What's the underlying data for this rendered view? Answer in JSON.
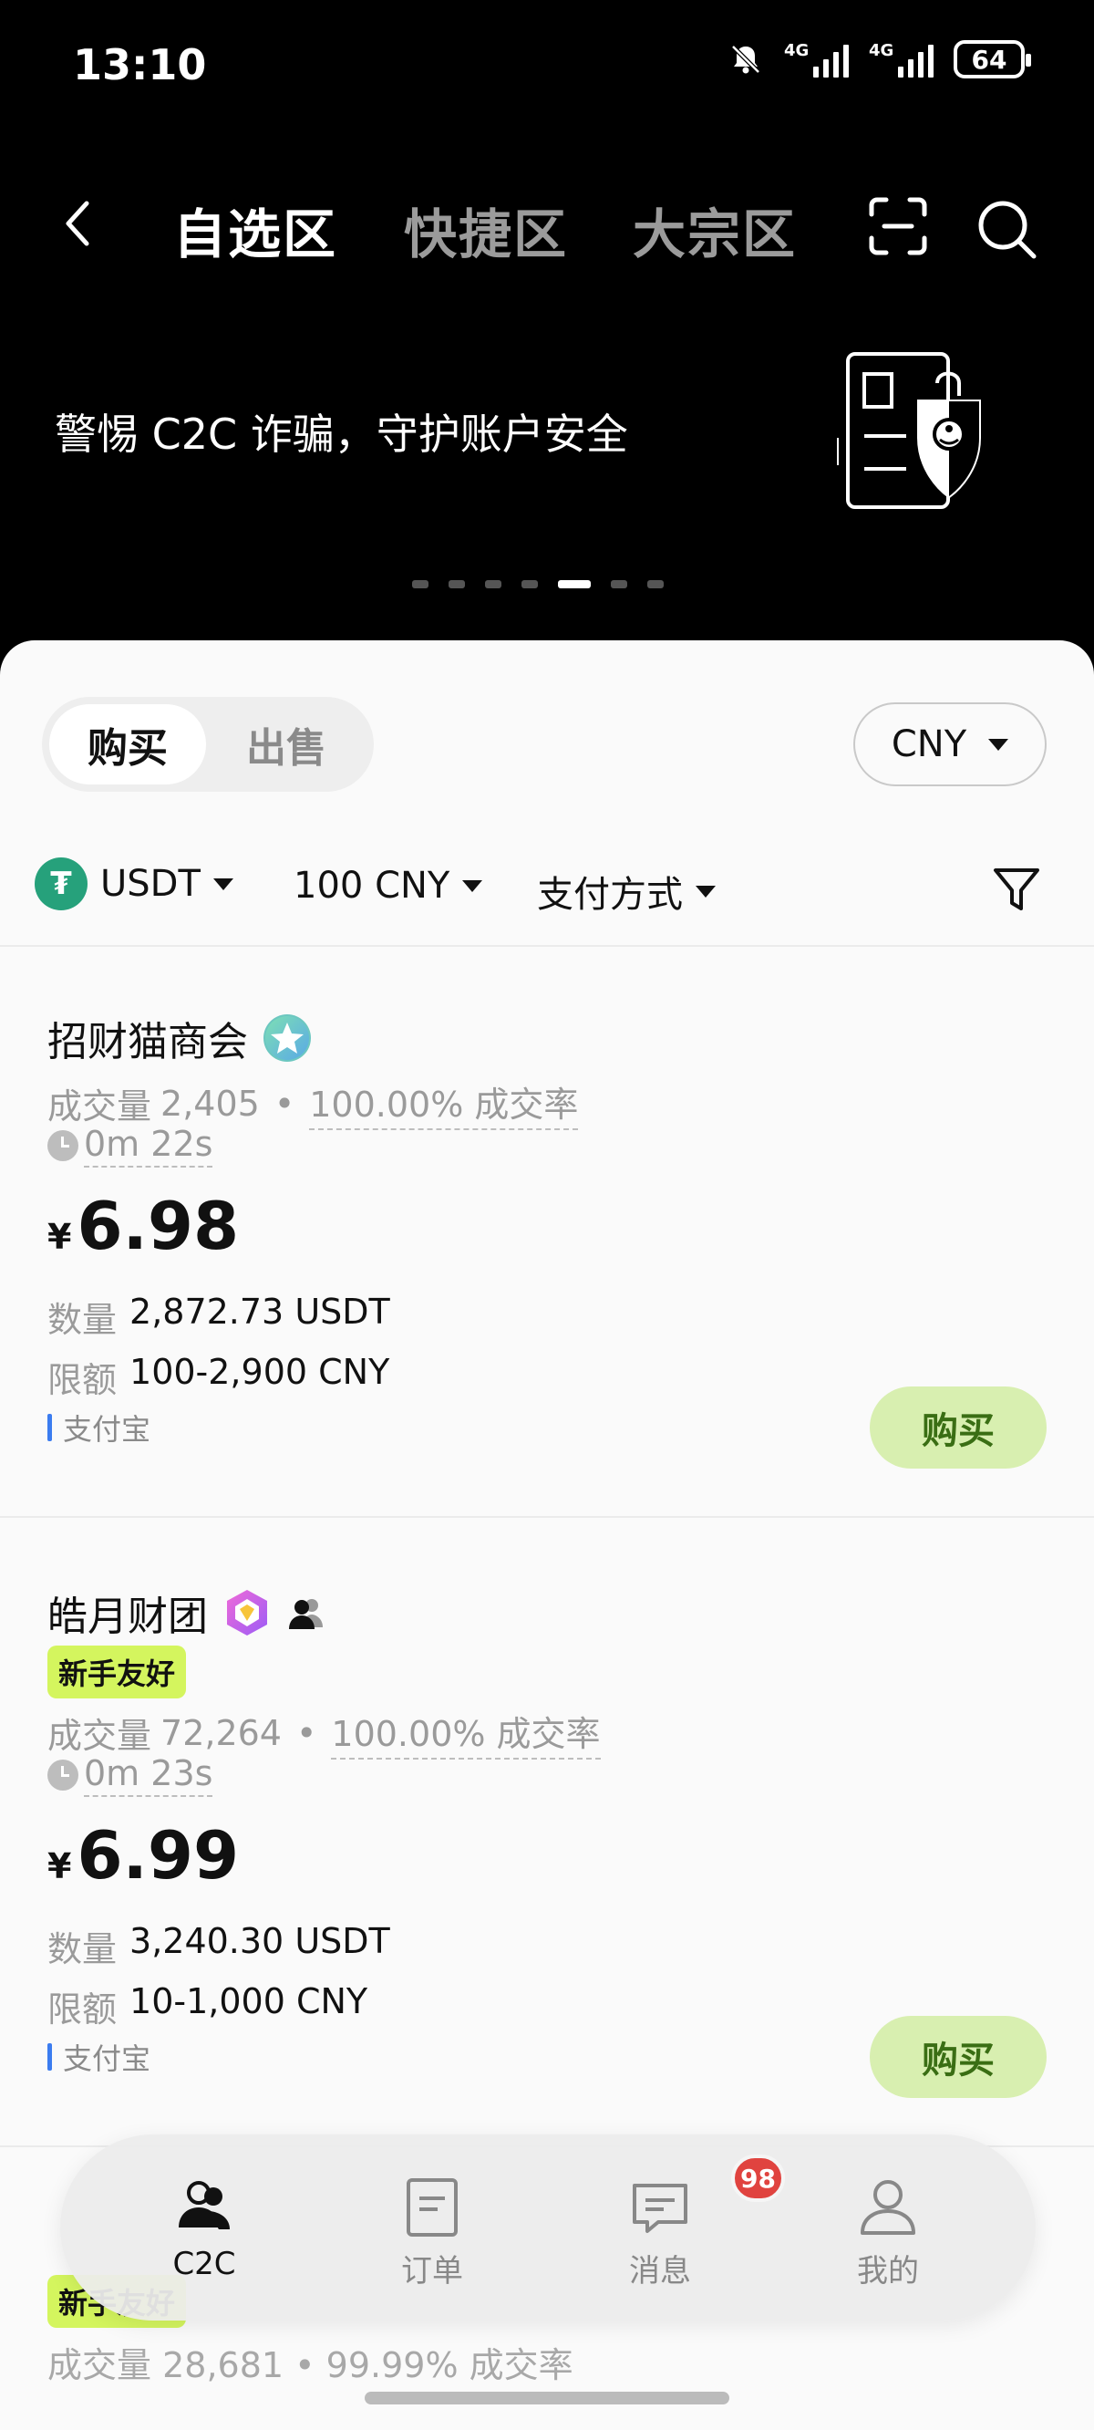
{
  "status_bar": {
    "time": "13:10",
    "network1": "4G",
    "network2": "4G",
    "battery": "64"
  },
  "nav": {
    "tabs": [
      "自选区",
      "快捷区",
      "大宗区"
    ]
  },
  "banner": {
    "text": "警惕 C2C 诈骗，守护账户安全",
    "page_count": 7,
    "active_page": 5
  },
  "trade": {
    "buy_label": "购买",
    "sell_label": "出售",
    "currency": "CNY"
  },
  "filters": {
    "coin": "USDT",
    "amount": "100 CNY",
    "payment": "支付方式"
  },
  "listings": [
    {
      "name": "招财猫商会",
      "badge_icon": "star-verified-icon",
      "volume_label": "成交量",
      "volume": "2,405",
      "rate": "100.00% 成交率",
      "time": "0m 22s",
      "currency_symbol": "¥",
      "price": "6.98",
      "qty_label": "数量",
      "qty": "2,872.73 USDT",
      "limit_label": "限额",
      "limit": "100-2,900 CNY",
      "payment": "支付宝",
      "button": "购买"
    },
    {
      "name": "皓月财团",
      "badge_icon": "diamond-badge-icon",
      "tag": "新手友好",
      "volume_label": "成交量",
      "volume": "72,264",
      "rate": "100.00% 成交率",
      "time": "0m 23s",
      "currency_symbol": "¥",
      "price": "6.99",
      "qty_label": "数量",
      "qty": "3,240.30 USDT",
      "limit_label": "限额",
      "limit": "10-1,000 CNY",
      "payment": "支付宝",
      "button": "购买"
    },
    {
      "tag": "新手友好",
      "volume_label": "成交量",
      "volume": "28,681",
      "rate": "99.99% 成交率"
    }
  ],
  "bottom_nav": {
    "items": [
      {
        "label": "C2C",
        "icon": "users-icon",
        "active": true
      },
      {
        "label": "订单",
        "icon": "document-icon"
      },
      {
        "label": "消息",
        "icon": "chat-icon",
        "badge": "98"
      },
      {
        "label": "我的",
        "icon": "person-icon"
      }
    ]
  },
  "colors": {
    "accent_green": "#d8efb0",
    "accent_text": "#3a6e14",
    "tag_lime": "#d4f55e",
    "badge_red": "#e0433f",
    "tether": "#26a17b"
  }
}
